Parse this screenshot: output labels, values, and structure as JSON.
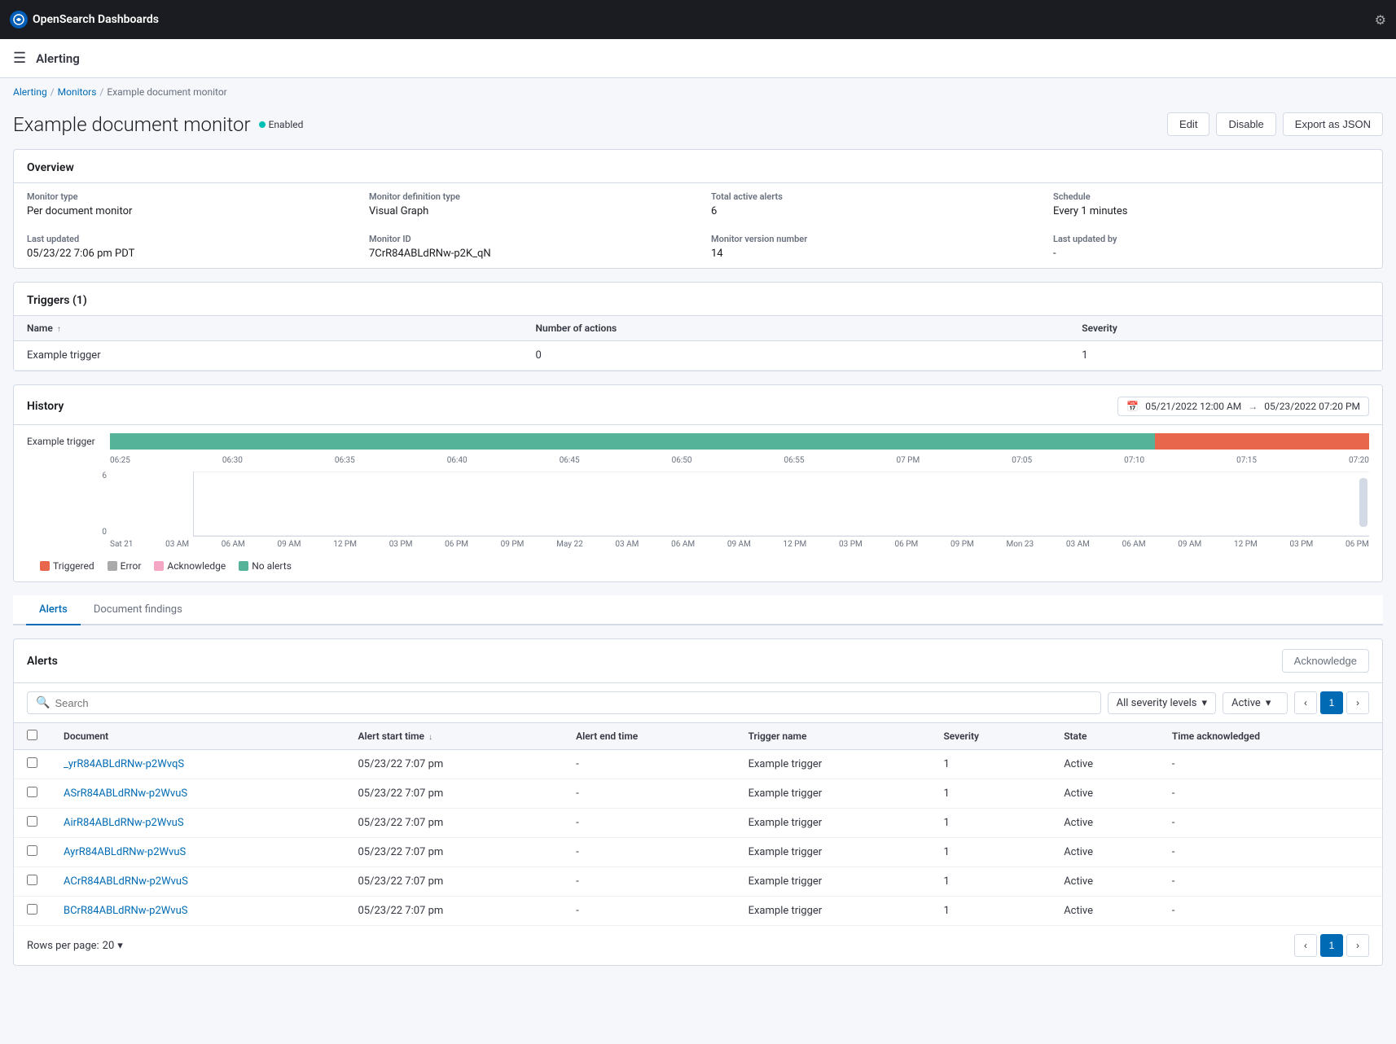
{
  "app": {
    "name": "OpenSearch Dashboards",
    "nav_title": "Alerting",
    "settings_icon": "⚙"
  },
  "breadcrumb": {
    "items": [
      "Alerting",
      "Monitors",
      "Example document monitor"
    ],
    "separators": [
      "/",
      "/"
    ]
  },
  "page": {
    "title": "Example document monitor",
    "status_label": "Enabled",
    "status_color": "#00BFB3"
  },
  "header_buttons": {
    "edit": "Edit",
    "disable": "Disable",
    "export_json": "Export as JSON"
  },
  "overview": {
    "title": "Overview",
    "fields": [
      {
        "label": "Monitor type",
        "value": "Per document monitor"
      },
      {
        "label": "Monitor definition type",
        "value": "Visual Graph"
      },
      {
        "label": "Total active alerts",
        "value": "6"
      },
      {
        "label": "Schedule",
        "value": "Every 1 minutes"
      },
      {
        "label": "Last updated",
        "value": "05/23/22 7:06 pm PDT"
      },
      {
        "label": "Monitor ID",
        "value": "7CrR84ABLdRNw-p2K_qN"
      },
      {
        "label": "Monitor version number",
        "value": "14"
      },
      {
        "label": "Last updated by",
        "value": "-"
      }
    ]
  },
  "triggers": {
    "title": "Triggers (1)",
    "columns": [
      "Name",
      "Number of actions",
      "Severity"
    ],
    "rows": [
      {
        "name": "Example trigger",
        "actions": "0",
        "severity": "1"
      }
    ],
    "sort_col": "Name"
  },
  "history": {
    "title": "History",
    "date_range": {
      "start": "05/21/2022 12:00 AM",
      "end": "05/23/2022 07:20 PM"
    },
    "trigger_name": "Example trigger",
    "time_labels": [
      "06:25",
      "06:30",
      "06:35",
      "06:40",
      "06:45",
      "06:50",
      "06:55",
      "07 PM",
      "07:05",
      "07:10",
      "07:15",
      "07:20"
    ],
    "x_axis_dates": [
      "Sat 21",
      "03 AM",
      "06 AM",
      "09 AM",
      "12 PM",
      "03 PM",
      "06 PM",
      "09 PM",
      "May 22",
      "03 AM",
      "06 AM",
      "09 AM",
      "12 PM",
      "03 PM",
      "06 PM",
      "09 PM",
      "Mon 23",
      "03 AM",
      "06 AM",
      "09 AM",
      "12 PM",
      "03 PM",
      "06 PM"
    ],
    "y_axis": [
      "6",
      "0"
    ],
    "legend": [
      {
        "label": "Triggered",
        "color": "#E7664C"
      },
      {
        "label": "Error",
        "color": "#aaa"
      },
      {
        "label": "Acknowledge",
        "color": "#F5A6C4"
      },
      {
        "label": "No alerts",
        "color": "#54B399"
      }
    ]
  },
  "tabs": [
    {
      "label": "Alerts",
      "active": true
    },
    {
      "label": "Document findings",
      "active": false
    }
  ],
  "alerts": {
    "title": "Alerts",
    "acknowledge_btn": "Acknowledge",
    "search_placeholder": "Search",
    "severity_filter": "All severity levels",
    "state_filter": "Active",
    "columns": [
      "Document",
      "Alert start time",
      "Alert end time",
      "Trigger name",
      "Severity",
      "State",
      "Time acknowledged"
    ],
    "rows": [
      {
        "doc": "_yrR84ABLdRNw-p2WvqS",
        "start": "05/23/22 7:07 pm",
        "end": "-",
        "trigger": "Example trigger",
        "severity": "1",
        "state": "Active",
        "ack": "-"
      },
      {
        "doc": "ASrR84ABLdRNw-p2WvuS",
        "start": "05/23/22 7:07 pm",
        "end": "-",
        "trigger": "Example trigger",
        "severity": "1",
        "state": "Active",
        "ack": "-"
      },
      {
        "doc": "AirR84ABLdRNw-p2WvuS",
        "start": "05/23/22 7:07 pm",
        "end": "-",
        "trigger": "Example trigger",
        "severity": "1",
        "state": "Active",
        "ack": "-"
      },
      {
        "doc": "AyrR84ABLdRNw-p2WvuS",
        "start": "05/23/22 7:07 pm",
        "end": "-",
        "trigger": "Example trigger",
        "severity": "1",
        "state": "Active",
        "ack": "-"
      },
      {
        "doc": "ACrR84ABLdRNw-p2WvuS",
        "start": "05/23/22 7:07 pm",
        "end": "-",
        "trigger": "Example trigger",
        "severity": "1",
        "state": "Active",
        "ack": "-"
      },
      {
        "doc": "BCrR84ABLdRNw-p2WvuS",
        "start": "05/23/22 7:07 pm",
        "end": "-",
        "trigger": "Example trigger",
        "severity": "1",
        "state": "Active",
        "ack": "-"
      }
    ],
    "rows_per_page": "20",
    "current_page": "1"
  }
}
